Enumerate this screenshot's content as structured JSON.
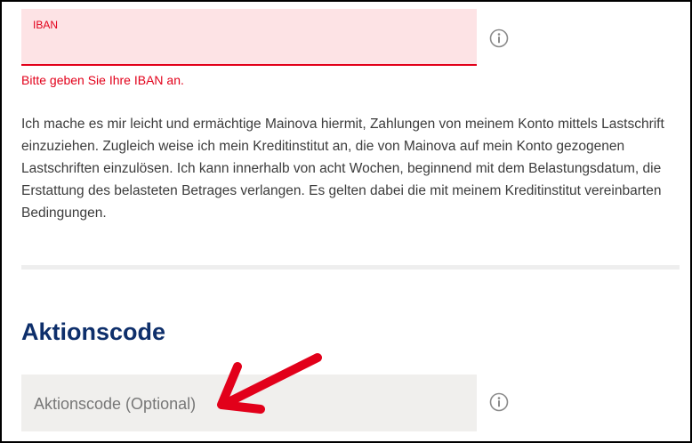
{
  "iban": {
    "label": "IBAN",
    "value": "",
    "error": "Bitte geben Sie Ihre IBAN an."
  },
  "mandate": {
    "text": "Ich mache es mir leicht und ermächtige Mainova hiermit, Zahlungen von meinem Konto mittels Lastschrift einzuziehen. Zugleich weise ich mein Kreditinstitut an, die von Mainova auf mein Konto gezogenen Lastschriften einzulösen. Ich kann innerhalb von acht Wochen, beginnend mit dem Belastungsdatum, die Erstattung des belasteten Betrages verlangen. Es gelten dabei die mit meinem Kreditinstitut vereinbarten Bedingungen."
  },
  "promo": {
    "heading": "Aktionscode",
    "placeholder": "Aktionscode (Optional)",
    "value": ""
  },
  "icons": {
    "info": "info-icon",
    "annotation": "arrow-icon"
  },
  "colors": {
    "error": "#e2001a",
    "error_bg": "#fde3e5",
    "heading": "#0e2f6b",
    "field_bg": "#f0efed",
    "annotation": "#e2001a"
  }
}
